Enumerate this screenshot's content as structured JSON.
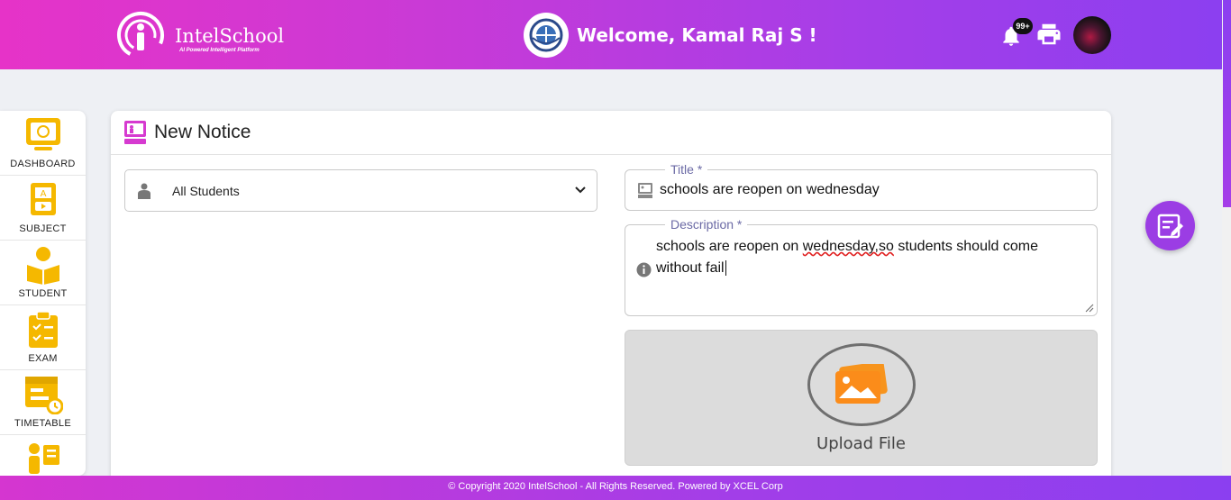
{
  "header": {
    "brand": "IntelSchool",
    "tagline": "AI Powered Intelligent Platform",
    "welcome": "Welcome, Kamal Raj S !",
    "notification_count": "99+"
  },
  "sidebar": {
    "items": [
      {
        "label": "DASHBOARD",
        "icon": "dashboard-icon"
      },
      {
        "label": "SUBJECT",
        "icon": "subject-icon"
      },
      {
        "label": "STUDENT",
        "icon": "student-icon"
      },
      {
        "label": "EXAM",
        "icon": "exam-icon"
      },
      {
        "label": "TIMETABLE",
        "icon": "timetable-icon"
      }
    ]
  },
  "notice": {
    "heading": "New Notice",
    "audience": {
      "selected": "All Students"
    },
    "title": {
      "label": "Title *",
      "value": "schools are reopen on wednesday"
    },
    "description": {
      "label": "Description *",
      "value_before": "schools are reopen on ",
      "value_misspelled": "wednesday,so",
      "value_after": " students should come without fail"
    },
    "upload_label": "Upload File"
  },
  "footer": {
    "text": "© Copyright 2020 IntelSchool - All Rights Reserved. Powered by XCEL Corp"
  },
  "colors": {
    "accent": "#9b3de4",
    "header_start": "#e633c8",
    "header_end": "#8b3ff0",
    "icon_yellow": "#f5b800"
  }
}
